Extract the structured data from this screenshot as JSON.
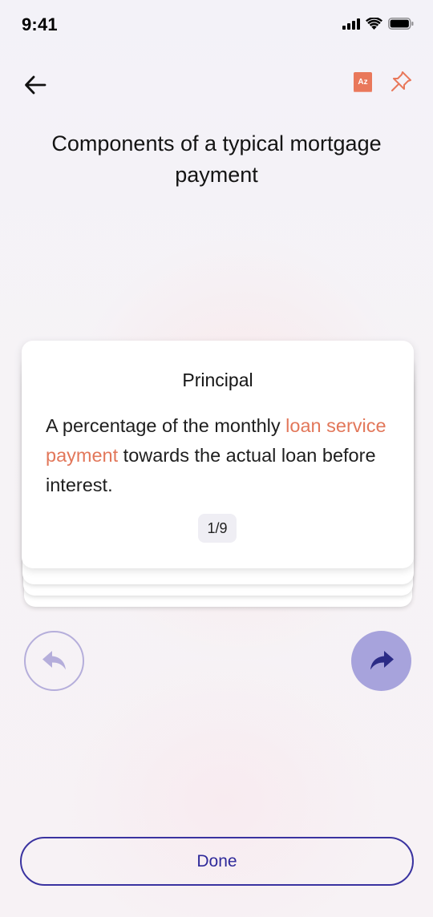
{
  "status_bar": {
    "time": "9:41",
    "icons": [
      "cellular-signal-icon",
      "wifi-icon",
      "battery-icon"
    ]
  },
  "header": {
    "back_icon": "arrow-left-icon",
    "glossary_icon": "glossary-az-icon",
    "glossary_label": "Az",
    "pin_icon": "pin-icon"
  },
  "title": "Components of a typical mortgage payment",
  "card": {
    "term": "Principal",
    "definition_parts": {
      "before": "A percentage of the monthly ",
      "highlight": "loan service payment",
      "after": " towards the actual loan before interest."
    },
    "position": "1/9"
  },
  "navigation": {
    "prev_icon": "undo-arrow-icon",
    "next_icon": "redo-arrow-icon"
  },
  "done_label": "Done",
  "colors": {
    "accent": "#3a33a0",
    "highlight": "#e2775a",
    "next_button": "#a7a3dc",
    "prev_border": "#b5aedb",
    "icon_orange": "#e9785b"
  }
}
